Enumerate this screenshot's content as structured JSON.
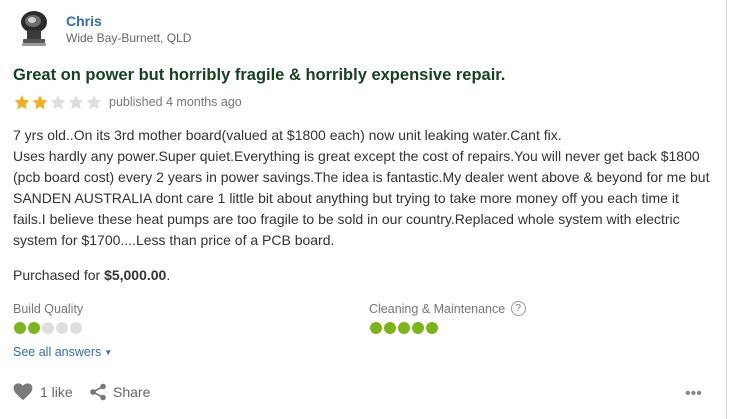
{
  "author": {
    "name": "Chris",
    "location": "Wide Bay-Burnett, QLD",
    "avatar_icon": "heat-pump-avatar-icon"
  },
  "review": {
    "title": "Great on power but horribly fragile & horribly expensive repair.",
    "rating": 2,
    "rating_max": 5,
    "published": "published 4 months ago",
    "body": "7 yrs old..On its 3rd mother board(valued at $1800 each) now unit leaking water.Cant fix.\nUses hardly any power.Super quiet.Everything is great except the cost of repairs.You will never get back $1800\n(pcb board cost) every 2 years in power savings.The idea is fantastic.My dealer went above & beyond for me but\nSANDEN AUSTRALIA dont care 1 little bit about anything but trying to take more money off you each time it\nfails.I believe these heat pumps are too fragile to be sold in our country.Replaced whole system with electric\nsystem for $1700....Less than price of a PCB board.",
    "purchased_prefix": "Purchased for ",
    "purchased_price": "$5,000.00",
    "purchased_suffix": "."
  },
  "attributes": [
    {
      "label": "Build Quality",
      "score": 2,
      "max": 5,
      "has_help": false
    },
    {
      "label": "Cleaning & Maintenance",
      "score": 5,
      "max": 5,
      "has_help": true
    }
  ],
  "help_glyph": "?",
  "see_all": {
    "label": "See all answers",
    "caret": "▼"
  },
  "actions": {
    "like_label": "1 like",
    "share_label": "Share",
    "more_label": "•••"
  },
  "colors": {
    "star_on": "#f2b01e",
    "star_off": "#dddddd",
    "dot_on": "#7cb518",
    "dot_off": "#dedede",
    "link": "#2f6fb5",
    "title": "#15431e"
  }
}
